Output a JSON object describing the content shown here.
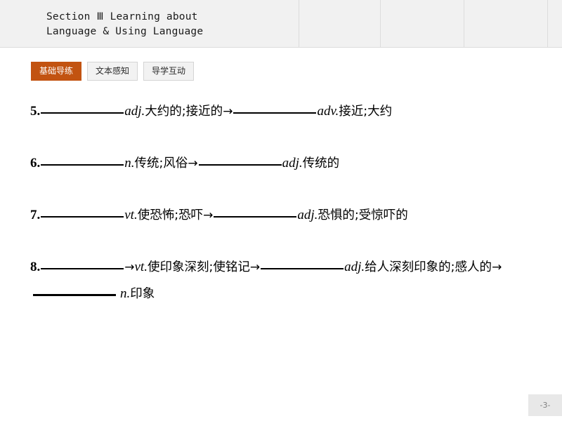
{
  "header": {
    "title": "Section Ⅲ  Learning about\nLanguage & Using Language"
  },
  "tabs": [
    {
      "label": "基础导练",
      "active": true
    },
    {
      "label": "文本感知",
      "active": false
    },
    {
      "label": "导学互动",
      "active": false
    }
  ],
  "colors": {
    "active_tab_bg": "#c25311",
    "banner_bg": "#f1f1f1",
    "divider": "#dcdcdc",
    "page_box_bg": "#e8e8e8"
  },
  "items": [
    {
      "number": "5.",
      "pos1": "adj.",
      "meaning1": "大约的;接近的",
      "arrow1": "→",
      "pos2": "adv.",
      "meaning2": "接近;大约"
    },
    {
      "number": "6.",
      "pos1": "n.",
      "meaning1": "传统;风俗",
      "arrow1": "→",
      "pos2": "adj.",
      "meaning2": "传统的"
    },
    {
      "number": "7.",
      "pos1": "vt.",
      "meaning1": "使恐怖;恐吓",
      "arrow1": "→",
      "pos2": "adj.",
      "meaning2": "恐惧的;受惊吓的"
    },
    {
      "number": "8.",
      "arrow0": "→",
      "pos1": "vt.",
      "meaning1": "使印象深刻;使铭记",
      "arrow1": "→",
      "pos2": "adj.",
      "meaning2": "给人深刻印象的;感人的",
      "arrow2": "→",
      "pos3": "n.",
      "meaning3": "印象"
    }
  ],
  "footer": {
    "page_number": "-3-"
  }
}
